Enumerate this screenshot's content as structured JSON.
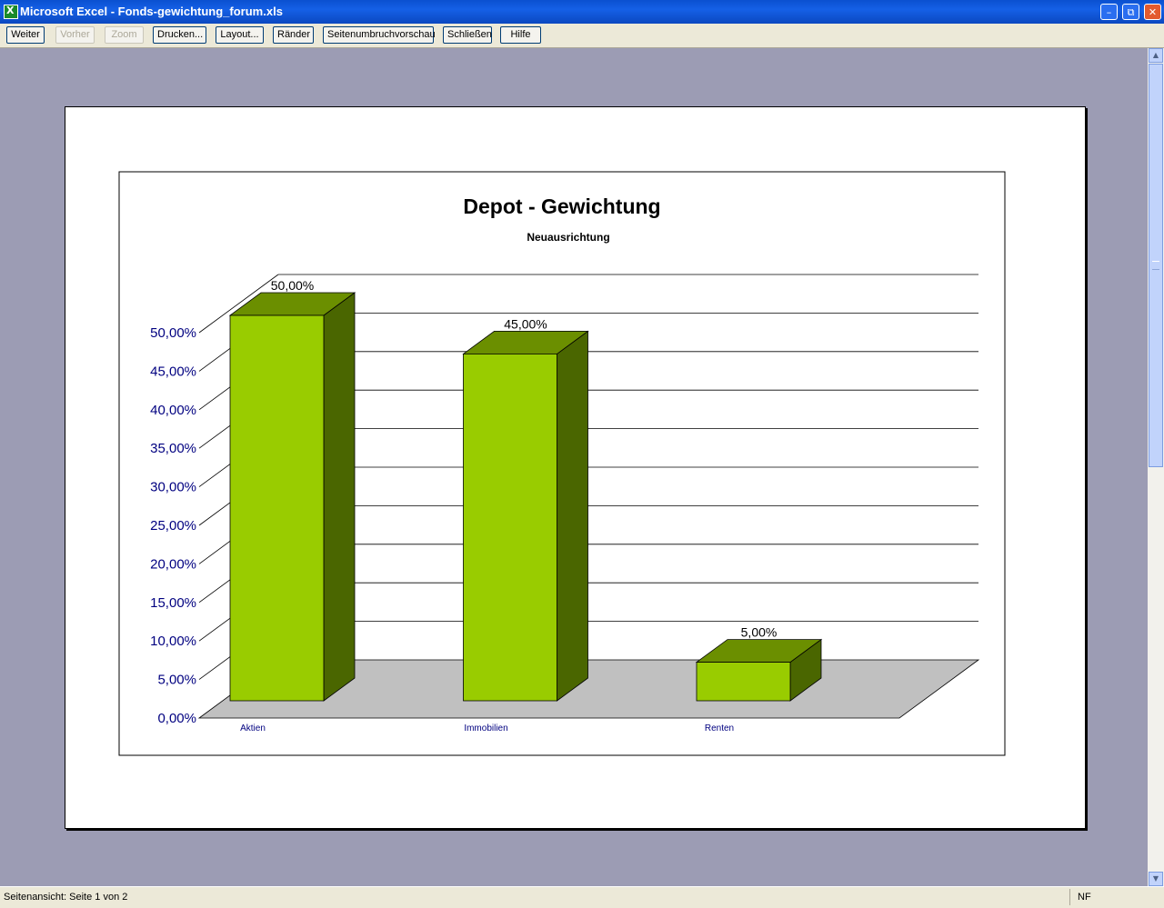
{
  "window": {
    "title": "Microsoft Excel - Fonds-gewichtung_forum.xls",
    "app_icon": "excel-icon",
    "controls": {
      "minimize": "–",
      "restore": "⧉",
      "close": "✕"
    }
  },
  "toolbar": {
    "buttons": [
      {
        "label": "Weiter",
        "enabled": true
      },
      {
        "label": "Vorher",
        "enabled": false
      },
      {
        "label": "Zoom",
        "enabled": false
      },
      {
        "label": "Drucken...",
        "enabled": true
      },
      {
        "label": "Layout...",
        "enabled": true
      },
      {
        "label": "Ränder",
        "enabled": true
      },
      {
        "label": "Seitenumbruchvorschau",
        "enabled": true
      },
      {
        "label": "Schließen",
        "enabled": true
      },
      {
        "label": "Hilfe",
        "enabled": true
      }
    ]
  },
  "status": {
    "text": "Seitenansicht: Seite 1 von 2",
    "indicator": "NF"
  },
  "chart_data": {
    "type": "bar",
    "style": "3d-column",
    "title": "Depot - Gewichtung",
    "subtitle": "Neuausrichtung",
    "categories": [
      "Aktien",
      "Immobilien",
      "Renten"
    ],
    "values": [
      50,
      45,
      5
    ],
    "data_labels": [
      "50,00%",
      "45,00%",
      "5,00%"
    ],
    "ylim": [
      0,
      50
    ],
    "y_ticks": [
      "0,00%",
      "5,00%",
      "10,00%",
      "15,00%",
      "20,00%",
      "25,00%",
      "30,00%",
      "35,00%",
      "40,00%",
      "45,00%",
      "50,00%"
    ],
    "grid": true,
    "legend": "none",
    "colors": {
      "bar_front": "#99cc00",
      "bar_top": "#6b8f00",
      "bar_side": "#4a6600",
      "floor": "#c0c0c0",
      "tick_label": "#000080"
    }
  }
}
